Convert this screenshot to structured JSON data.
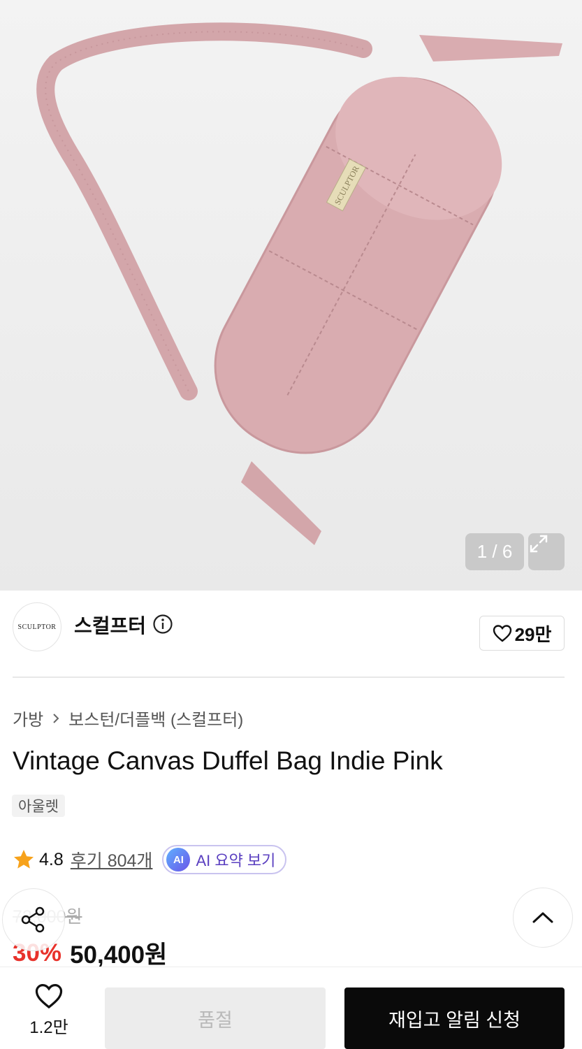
{
  "gallery": {
    "counter": "1 / 6",
    "bag_label": "SCULPTOR",
    "expand_icon": "expand-icon"
  },
  "brand": {
    "logo_text": "SCULPTOR",
    "name": "스컬프터",
    "info_icon": "info-icon",
    "likes": "29만",
    "heart_icon": "heart-icon"
  },
  "breadcrumb": {
    "category": "가방",
    "subcategory": "보스턴/더플백 (스컬프터)"
  },
  "product": {
    "title": "Vintage Canvas Duffel Bag Indie Pink",
    "tag": "아울렛",
    "rating": "4.8",
    "reviews": "후기 804개",
    "ai_badge": "AI",
    "ai_label": "AI 요약 보기",
    "original_price": "72,000원",
    "discount": "30%",
    "price": "50,400원"
  },
  "actions": {
    "share_icon": "share-icon",
    "scroll_top_icon": "chevron-up-icon",
    "wish_count": "1.2만",
    "soldout_label": "품절",
    "restock_label": "재입고 알림 신청"
  },
  "colors": {
    "bag_pink": "#d9acb0",
    "discount_red": "#e8322b",
    "ai_purple": "#5a3fc0"
  }
}
